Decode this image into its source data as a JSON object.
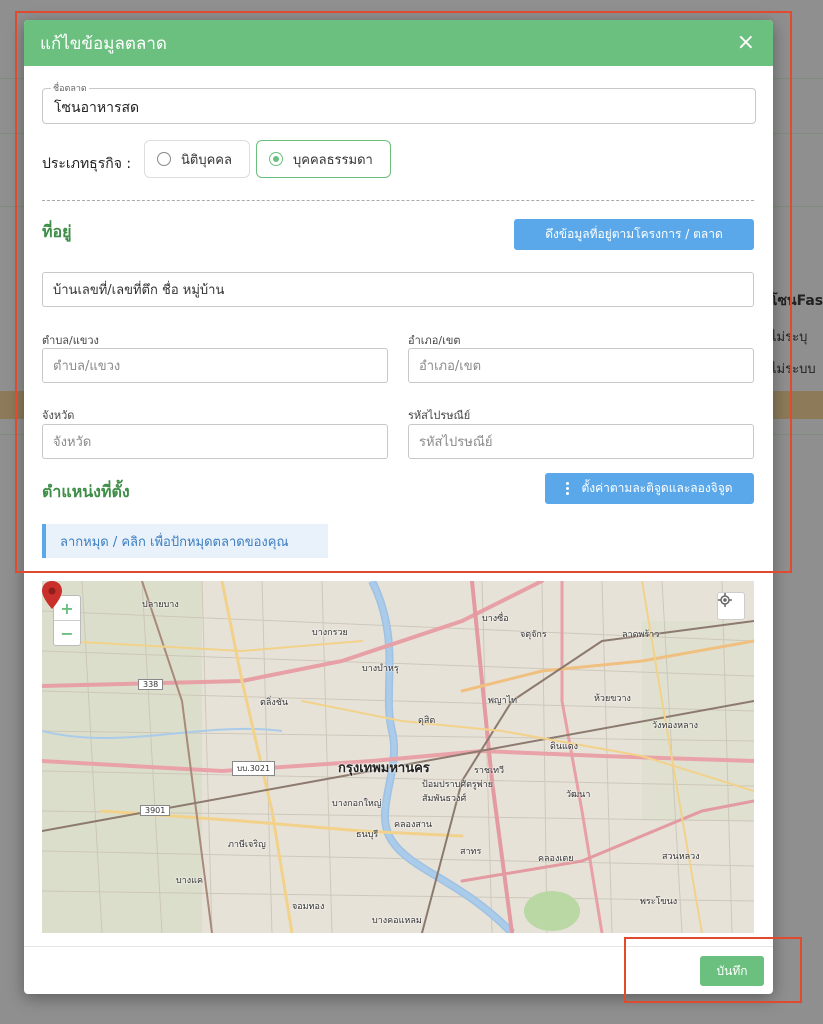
{
  "modal": {
    "title": "แก้ไขข้อมูลตลาด",
    "close_icon": "×"
  },
  "market_name": {
    "label": "ชื่อตลาด",
    "value": "โซนอาหารสด"
  },
  "business_type": {
    "label": "ประเภทธุรกิจ :",
    "options": [
      {
        "label": "นิติบุคคล",
        "selected": false
      },
      {
        "label": "บุคคลธรรมดา",
        "selected": true
      }
    ]
  },
  "address": {
    "section_title": "ที่อยู่",
    "fetch_button": "ดึงข้อมูลที่อยู่ตามโครงการ / ตลาด",
    "line_placeholder": "บ้านเลขที่/เลขที่ตึก ชื่อ หมู่บ้าน",
    "subdistrict_label": "ตำบล/แขวง",
    "subdistrict_placeholder": "ตำบล/แขวง",
    "district_label": "อำเภอ/เขต",
    "district_placeholder": "อำเภอ/เขต",
    "province_label": "จังหวัด",
    "province_placeholder": "จังหวัด",
    "postal_label": "รหัสไปรษณีย์",
    "postal_placeholder": "รหัสไปรษณีย์"
  },
  "location": {
    "section_title": "ตำแหน่งที่ตั้ง",
    "set_latlng_button": "ตั้งค่าตามละติจูดและลองจิจูด",
    "hint": "ลากหมุด / คลิก เพื่อปักหมุดตลาดของคุณ"
  },
  "map": {
    "zoom_in": "+",
    "zoom_out": "−",
    "labels": [
      "ปลายบาง",
      "บางกรวย",
      "ตลิ่งชัน",
      "บางบำหรุ",
      "กรุงเทพมหานคร",
      "ป้อมปราบศัตรูพ่าย",
      "สัมพันธวงศ์",
      "บางกอกใหญ่",
      "ธนบุรี",
      "คลองสาน",
      "ภาษีเจริญ",
      "จอมทอง",
      "บางคอแหลม",
      "สาทร",
      "ราชเทวี",
      "พญาไท",
      "ดุสิต",
      "ดินแดง",
      "ห้วยขวาง",
      "วังทองหลาง",
      "จตุจักร",
      "บางซื่อ",
      "คลองเตย",
      "วัฒนา",
      "สวนหลวง",
      "บางแค",
      "ลาดพร้าว",
      "พระโขนง"
    ],
    "road_badges": [
      "338",
      "บบ.3021",
      "3901"
    ]
  },
  "background": {
    "title": "โซนFas",
    "line1": "ไม่ระบุ",
    "line2": "ไม่ระบบ"
  },
  "footer": {
    "save_button": "บันทึก"
  },
  "colors": {
    "header_green": "#6bc07f",
    "section_green": "#3e8e48",
    "button_blue": "#5aa8ea",
    "annotation_red": "#e04a2f"
  }
}
